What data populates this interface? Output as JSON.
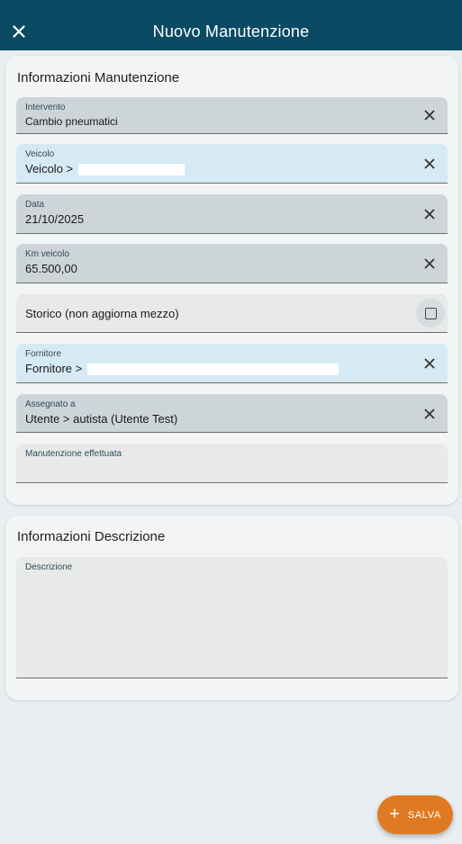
{
  "header": {
    "title": "Nuovo Manutenzione",
    "close_icon": "close-icon"
  },
  "info_card": {
    "title": "Informazioni Manutenzione",
    "fields": {
      "intervento": {
        "label": "Intervento",
        "value": "Cambio pneumatici"
      },
      "veicolo": {
        "label": "Veicolo",
        "value": "Veicolo >"
      },
      "data": {
        "label": "Data",
        "value": "21/10/2025"
      },
      "km_veicolo": {
        "label": "Km veicolo",
        "value": "65.500,00"
      },
      "storico": {
        "label": "Storico (non aggiorna mezzo)",
        "checked": false
      },
      "fornitore": {
        "label": "Fornitore",
        "value": "Fornitore >"
      },
      "assegnato": {
        "label": "Assegnato a",
        "value": "Utente > autista (Utente Test)"
      },
      "manutenzione_effettuata": {
        "label": "Manutenzione effettuata",
        "value": ""
      }
    }
  },
  "desc_card": {
    "title": "Informazioni Descrizione",
    "descrizione": {
      "label": "Descrizione",
      "value": ""
    }
  },
  "fab": {
    "label": "SALVA",
    "icon": "plus-icon"
  },
  "colors": {
    "header_bg": "#0a4a63",
    "accent": "#e07a22",
    "field_grey": "#cdd5d9",
    "field_blue": "#d6eaf4"
  }
}
